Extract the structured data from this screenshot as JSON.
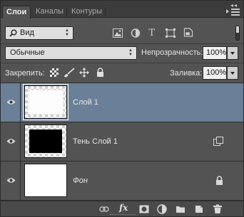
{
  "tabs": [
    {
      "label": "Слои",
      "active": true
    },
    {
      "label": "Каналы",
      "active": false
    },
    {
      "label": "Контуры",
      "active": false
    }
  ],
  "header": {
    "collapse_glyph": "◂◂"
  },
  "filter": {
    "label": "Вид",
    "icons": [
      "image-filter-icon",
      "adjustment-filter-icon",
      "text-filter-icon",
      "shape-filter-icon",
      "smart-object-filter-icon"
    ]
  },
  "blend": {
    "mode": "Обычные"
  },
  "opacity": {
    "label": "Непрозрачность:",
    "value": "100%"
  },
  "lock": {
    "label": "Закрепить:",
    "icons": [
      "lock-transparent-icon",
      "lock-brush-icon",
      "lock-move-icon",
      "lock-all-icon"
    ]
  },
  "fill": {
    "label": "Заливка:",
    "value": "100%"
  },
  "layers": [
    {
      "name": "Слой 1",
      "selected": true,
      "visible": true,
      "thumb": "white-selection"
    },
    {
      "name": "Тень Слой 1",
      "selected": false,
      "visible": true,
      "thumb": "black"
    },
    {
      "name": "Фон",
      "selected": false,
      "visible": true,
      "thumb": "white",
      "italic": true,
      "locked": true
    }
  ],
  "footer": {
    "fx_label": "fx",
    "icons": [
      "link-icon",
      "fx-icon",
      "mask-icon",
      "adjustment-icon",
      "folder-icon",
      "new-layer-icon",
      "trash-icon"
    ]
  },
  "colors": {
    "panel": "#535353",
    "selected_row": "#6a8098",
    "tabbar": "#3c3c3c"
  }
}
